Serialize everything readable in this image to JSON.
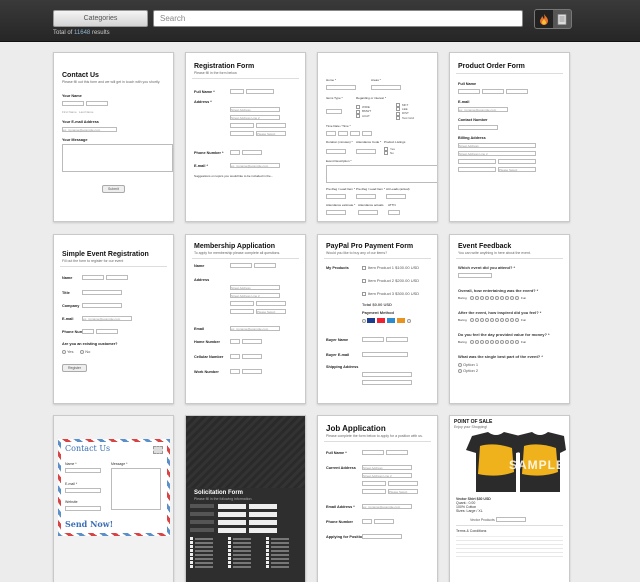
{
  "header": {
    "categories_label": "Categories",
    "search_placeholder": "Search",
    "total_prefix": "Total of",
    "total_count": "11648",
    "total_suffix": "results"
  },
  "cards": {
    "contact": {
      "title": "Contact Us",
      "subtitle": "Please fill out this form and we will get in touch with you shortly.",
      "name": "Your Name",
      "first": "First Name",
      "last": "Last Name",
      "email": "Your E-mail Address",
      "email_ph": "ex: myname@example.com",
      "message": "Your Message",
      "submit": "Submit"
    },
    "registration": {
      "title": "Registration Form",
      "subtitle": "Please fill in the form below.",
      "name": "Full Name *",
      "first": "First",
      "last": "Last",
      "address": "Address *",
      "street": "Street Address",
      "street2": "Street Address Line 2",
      "city": "City",
      "state": "State / Province",
      "zip": "Postal / Zip Code",
      "country": "Please Select",
      "phone": "Phone Number *",
      "area": "Area Code",
      "phone_num": "Phone Number",
      "email": "E-mail *",
      "email_ph": "ex: myname@example.com",
      "suggest": "Suggestions on topics you would like to be included in the..."
    },
    "misc": {
      "labels": [
        "Home *",
        "Areas *",
        "Items Type *",
        "Regarding or interest *",
        "Time Date / Time *",
        "Duration (minutes) *",
        "Attendance Code *",
        "Product Listings",
        "Event Description *",
        "Pre-Reg / Lead Item *",
        "Pre-Reg / Lead Item *",
        "Att Leads (actual)",
        "Attendance estimate *",
        "Attendance actuals",
        "ATTN"
      ],
      "opts": [
        "WIRE",
        "BMWT",
        "ACAT",
        "MKT",
        "LEE",
        "DIST",
        "Test Grid",
        "Yes",
        "No"
      ]
    },
    "product": {
      "title": "Product Order Form",
      "full_name": "Full Name",
      "first": "First Name",
      "middle": "Middle Name",
      "last": "Last Name",
      "email": "E-mail",
      "email_ph": "ex: myname@example.com",
      "contact": "Contact Number",
      "billing": "Billing Address",
      "street": "Street Address",
      "street2": "Street Address Line 2",
      "city": "City",
      "state": "State / Province",
      "zip": "Postal / Zip Code",
      "country": "Please Select"
    },
    "event": {
      "title": "Simple Event Registration",
      "subtitle": "Fill out the form to register for our event",
      "name": "Name",
      "first": "First Name",
      "last": "Last Name",
      "title_l": "Title",
      "company": "Company",
      "email": "E-mail",
      "email_ph": "ex: myname@example.com",
      "phone": "Phone Number",
      "area": "Area Code",
      "phone_num": "Phone Number",
      "existing": "Are you an existing customer?",
      "yes": "Yes",
      "no": "No",
      "register": "Register"
    },
    "membership": {
      "title": "Membership Application",
      "subtitle": "To apply for membership please complete all questions.",
      "name": "Name",
      "first": "First Name",
      "last": "Last Name",
      "address": "Address",
      "street": "Street Address",
      "street2": "Street Address Line 2",
      "city": "City",
      "state": "State / Province",
      "zip": "Postal / Zip Code",
      "country": "Please Select",
      "email": "Email",
      "email_ph": "ex: myname@example.com",
      "home": "Home Number",
      "cell": "Cellular Number",
      "work": "Work Number"
    },
    "paypal": {
      "title": "PayPal Pro Payment Form",
      "subtitle": "Would you like to buy any of our items?",
      "my_products": "My Products",
      "items": [
        "Item Product 1 $100.00 USD",
        "Item Product 2 $200.00 USD",
        "Item Product 3 $300.00 USD"
      ],
      "total": "Total $0.00 USD",
      "payment": "Payment Method",
      "buyer_name": "Buyer Name",
      "buyer_email": "Buyer E-mail",
      "shipping": "Shipping Address"
    },
    "feedback": {
      "title": "Event Feedback",
      "subtitle": "You can write anything in here about the event.",
      "q1": "Which event did you attend? *",
      "q2": "Overall, how entertaining was the event? *",
      "q3": "After the event, how inspired did you feel? *",
      "q4": "Do you feel the day provided value for money? *",
      "q5": "What was the single best part of the event? *",
      "boring": "Boring",
      "fun": "Fun",
      "option1": "Option 1",
      "option2": "Option 2"
    },
    "contact2": {
      "title": "Contact Us",
      "name": "Name *",
      "message": "Message *",
      "email": "E-mail *",
      "website": "Website",
      "send": "Send Now!"
    },
    "solicitation": {
      "title": "Solicitation Form",
      "subtitle": "Please fill in the following information."
    },
    "job": {
      "title": "Job Application",
      "subtitle": "Please complete the form below to apply for a position with us.",
      "full_name": "Full Name *",
      "first": "First Name",
      "last": "Last Name",
      "address": "Current Address",
      "street": "Street Address",
      "street2": "Street Address Line 2",
      "city": "City",
      "state": "State / Province",
      "zip": "Postal / Zip Code",
      "country": "Please Select",
      "email": "Email Address *",
      "email_ph": "ex: myname@example.com",
      "phone": "Phone Number",
      "applying": "Applying for Position *"
    },
    "pos": {
      "title": "POINT OF SALE",
      "subtitle": "Enjoy your Shopping!",
      "sample": "SAMPLE",
      "price": "Vector Shirt $30 USD",
      "qty": "Quant.: 0.00",
      "cotton": "100% Cotton",
      "size": "Sizes: Large / XL",
      "products": "Vector Products",
      "terms": "Terms & Conditions"
    }
  }
}
